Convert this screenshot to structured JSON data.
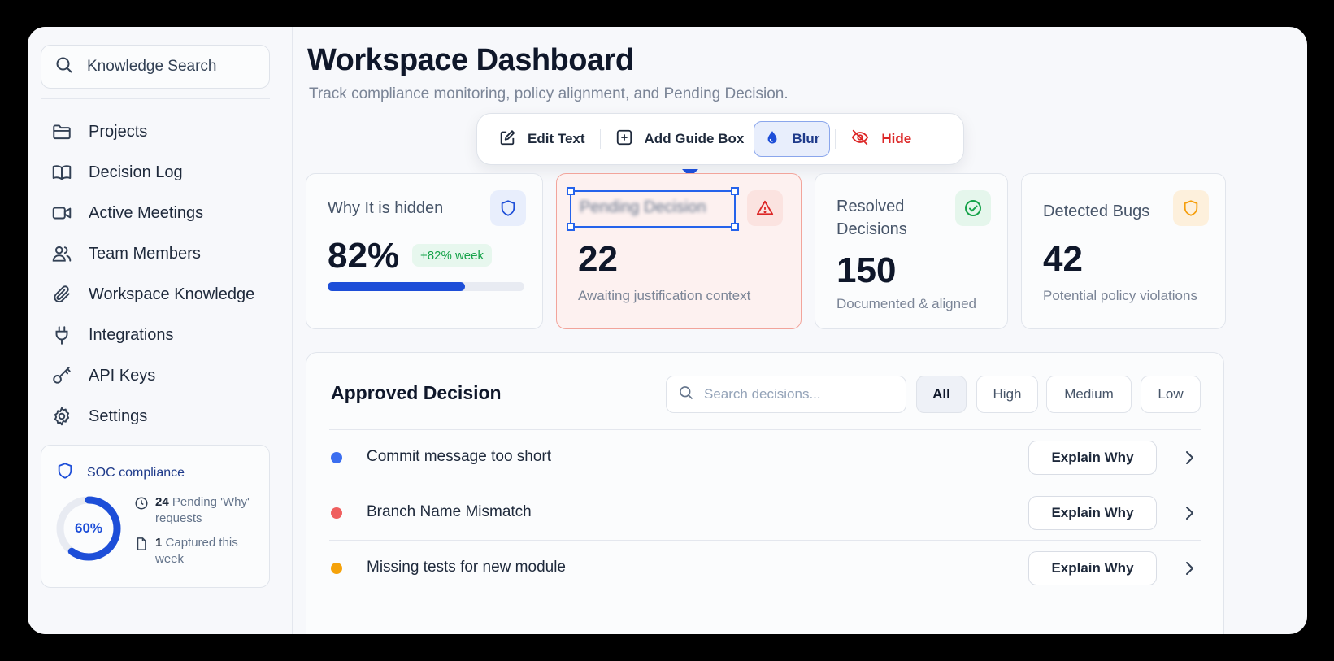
{
  "sidebar": {
    "search_label": "Knowledge Search",
    "items": [
      {
        "label": "Projects",
        "icon": "folder-icon"
      },
      {
        "label": "Decision Log",
        "icon": "book-icon"
      },
      {
        "label": "Active Meetings",
        "icon": "video-icon"
      },
      {
        "label": "Team Members",
        "icon": "users-icon"
      },
      {
        "label": "Workspace Knowledge",
        "icon": "paperclip-icon"
      },
      {
        "label": "Integrations",
        "icon": "plug-icon"
      },
      {
        "label": "API Keys",
        "icon": "key-icon"
      },
      {
        "label": "Settings",
        "icon": "gear-icon"
      }
    ],
    "compliance": {
      "title": "SOC compliance",
      "percent_label": "60%",
      "percent": 60,
      "pending_count": "24",
      "pending_text": "Pending 'Why' requests",
      "captured_count": "1",
      "captured_text": "Captured this week"
    }
  },
  "header": {
    "title": "Workspace Dashboard",
    "subtitle": "Track compliance monitoring, policy alignment, and Pending Decision."
  },
  "toolbar": {
    "edit_text": "Edit Text",
    "add_guide_box": "Add Guide Box",
    "blur": "Blur",
    "hide": "Hide"
  },
  "stats": {
    "hidden": {
      "label": "Why It is hidden",
      "value": "82%",
      "trend": "+82% week",
      "progress": 0.7
    },
    "pending": {
      "label": "Pending Decision",
      "value": "22",
      "desc": "Awaiting justification context"
    },
    "resolved": {
      "label_line1": "Resolved",
      "label_line2": "Decisions",
      "value": "150",
      "desc": "Documented & aligned"
    },
    "bugs": {
      "label": "Detected Bugs",
      "value": "42",
      "desc": "Potential policy violations"
    }
  },
  "decisions": {
    "title": "Approved Decision",
    "search_placeholder": "Search decisions...",
    "filters": [
      "All",
      "High",
      "Medium",
      "Low"
    ],
    "explain_label": "Explain Why",
    "rows": [
      {
        "name": "Commit message too short",
        "color": "#3b6ef0"
      },
      {
        "name": "Branch Name Mismatch",
        "color": "#ef5f5f"
      },
      {
        "name": "Missing tests for new module",
        "color": "#f5a20a"
      }
    ]
  },
  "colors": {
    "accent": "#1d4ed8",
    "danger": "#dc2626",
    "success": "#16a34a",
    "warning": "#f59e0b"
  }
}
